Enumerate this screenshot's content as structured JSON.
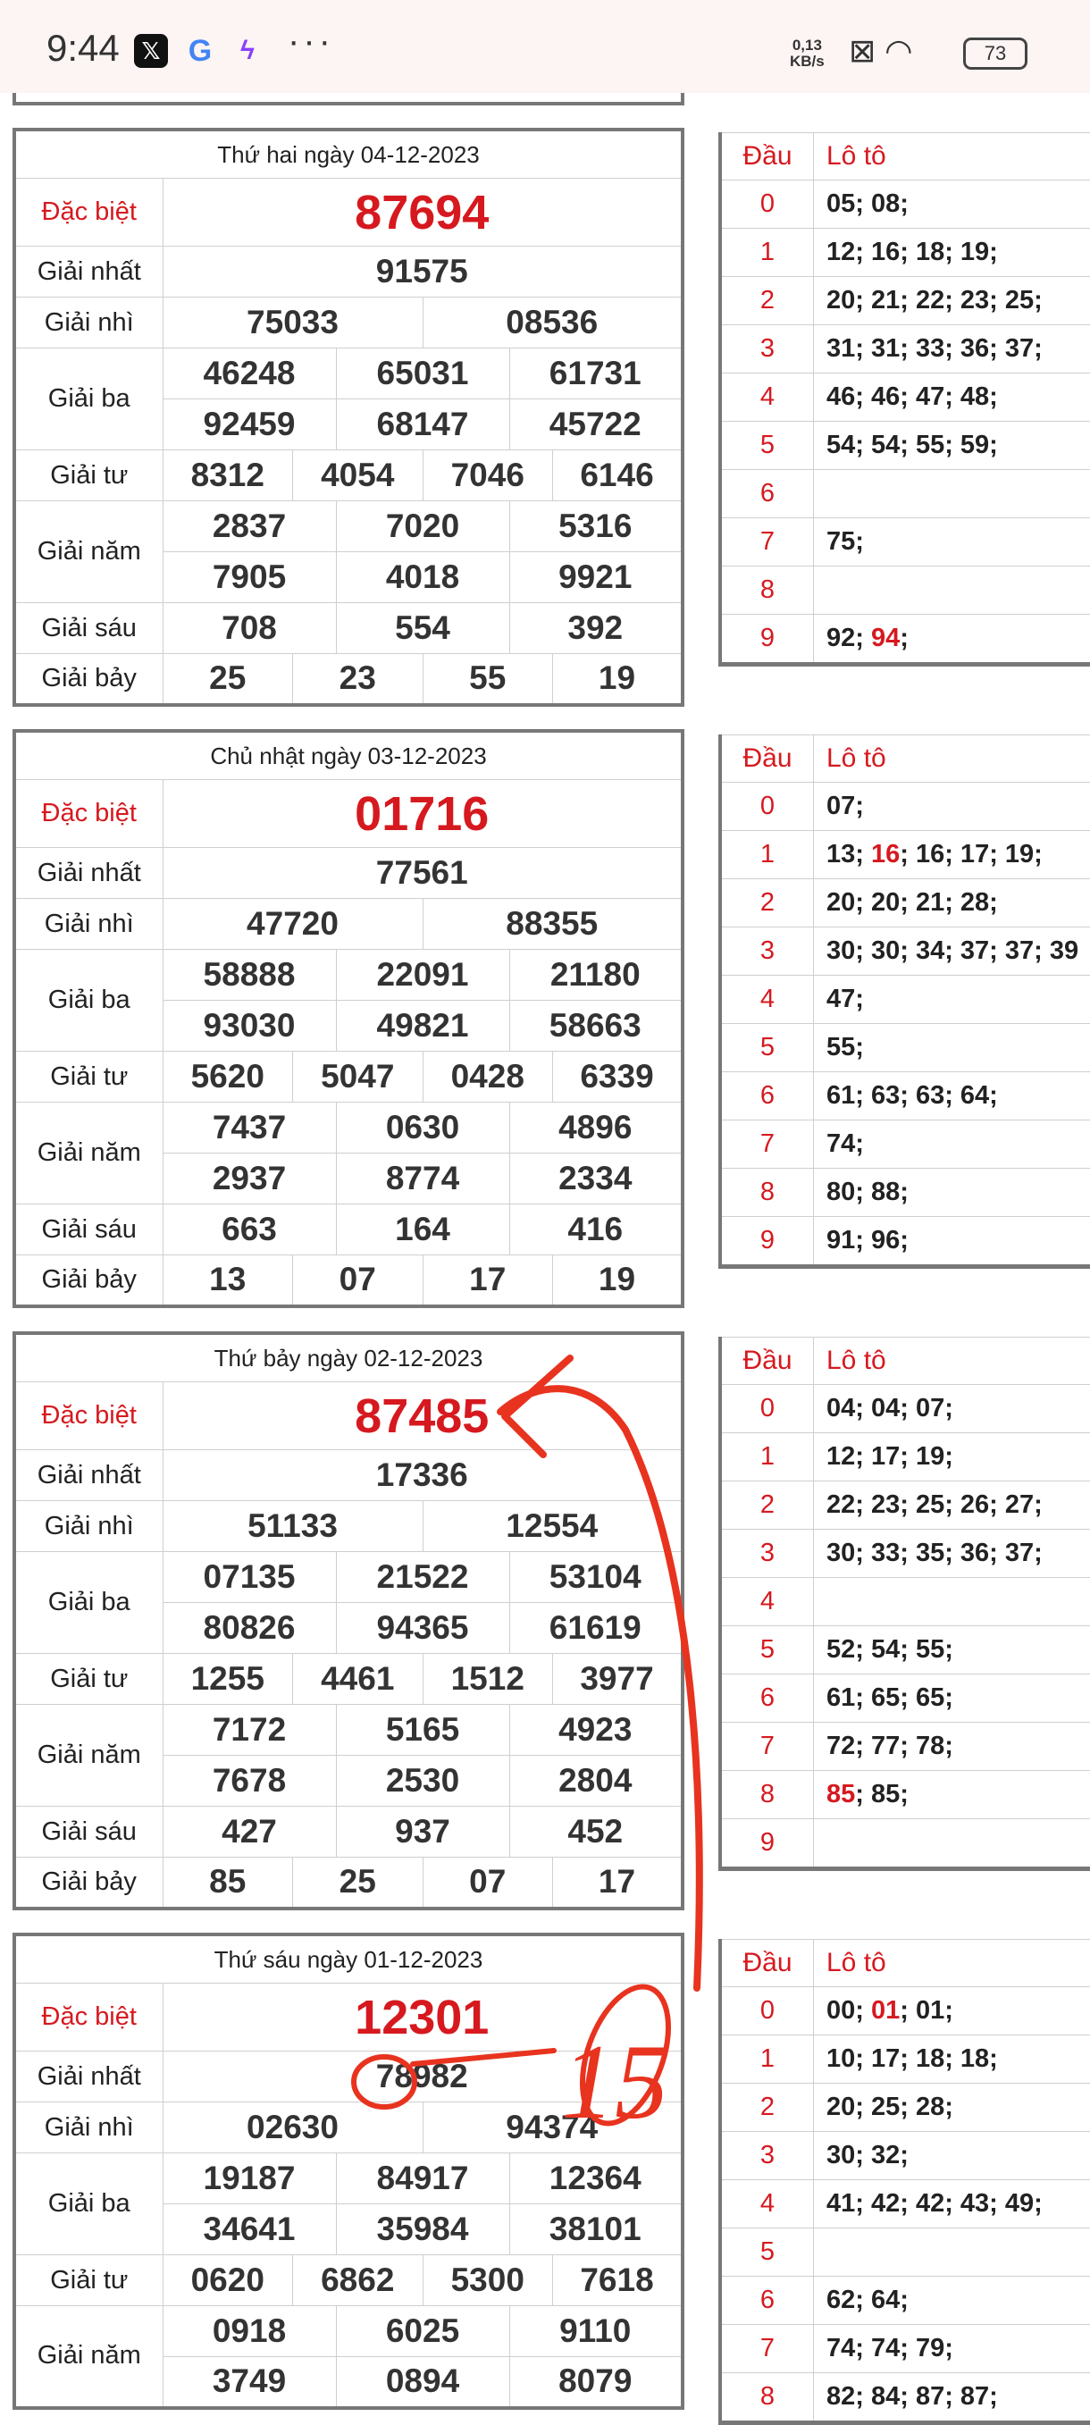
{
  "status_bar": {
    "time": "9:44",
    "apps": [
      "x-app-icon",
      "google-icon",
      "messenger-icon"
    ],
    "more": "···",
    "speed_value": "0,13",
    "speed_unit": "KB/s",
    "battery": "73"
  },
  "labels": {
    "db": "Đặc biệt",
    "g1": "Giải nhất",
    "g2": "Giải nhì",
    "g3": "Giải ba",
    "g4": "Giải tư",
    "g5": "Giải năm",
    "g6": "Giải sáu",
    "g7": "Giải bảy",
    "dau": "Đầu",
    "loto": "Lô tô"
  },
  "draws": [
    {
      "date_title": "Thứ hai ngày 04-12-2023",
      "db": "87694",
      "g1": "91575",
      "g2": [
        "75033",
        "08536"
      ],
      "g3": [
        "46248",
        "65031",
        "61731",
        "92459",
        "68147",
        "45722"
      ],
      "g4": [
        "8312",
        "4054",
        "7046",
        "6146"
      ],
      "g5": [
        "2837",
        "7020",
        "5316",
        "7905",
        "4018",
        "9921"
      ],
      "g6": [
        "708",
        "554",
        "392"
      ],
      "g7": [
        "25",
        "23",
        "55",
        "19"
      ],
      "loto": [
        {
          "d": "0",
          "pre": "05; 08;",
          "hl": "",
          "post": ""
        },
        {
          "d": "1",
          "pre": "12; 16; 18; 19;",
          "hl": "",
          "post": ""
        },
        {
          "d": "2",
          "pre": "20; 21; 22; 23; 25;",
          "hl": "",
          "post": ""
        },
        {
          "d": "3",
          "pre": "31; 31; 33; 36; 37;",
          "hl": "",
          "post": ""
        },
        {
          "d": "4",
          "pre": "46; 46; 47; 48;",
          "hl": "",
          "post": ""
        },
        {
          "d": "5",
          "pre": "54; 54; 55; 59;",
          "hl": "",
          "post": ""
        },
        {
          "d": "6",
          "pre": "",
          "hl": "",
          "post": ""
        },
        {
          "d": "7",
          "pre": "75;",
          "hl": "",
          "post": ""
        },
        {
          "d": "8",
          "pre": "",
          "hl": "",
          "post": ""
        },
        {
          "d": "9",
          "pre": "92; ",
          "hl": "94",
          "post": ";"
        }
      ]
    },
    {
      "date_title": "Chủ nhật ngày 03-12-2023",
      "db": "01716",
      "g1": "77561",
      "g2": [
        "47720",
        "88355"
      ],
      "g3": [
        "58888",
        "22091",
        "21180",
        "93030",
        "49821",
        "58663"
      ],
      "g4": [
        "5620",
        "5047",
        "0428",
        "6339"
      ],
      "g5": [
        "7437",
        "0630",
        "4896",
        "2937",
        "8774",
        "2334"
      ],
      "g6": [
        "663",
        "164",
        "416"
      ],
      "g7": [
        "13",
        "07",
        "17",
        "19"
      ],
      "loto": [
        {
          "d": "0",
          "pre": "07;",
          "hl": "",
          "post": ""
        },
        {
          "d": "1",
          "pre": "13; ",
          "hl": "16",
          "post": "; 16; 17; 19;"
        },
        {
          "d": "2",
          "pre": "20; 20; 21; 28;",
          "hl": "",
          "post": ""
        },
        {
          "d": "3",
          "pre": "30; 30; 34; 37; 37; 39",
          "hl": "",
          "post": ""
        },
        {
          "d": "4",
          "pre": "47;",
          "hl": "",
          "post": ""
        },
        {
          "d": "5",
          "pre": "55;",
          "hl": "",
          "post": ""
        },
        {
          "d": "6",
          "pre": "61; 63; 63; 64;",
          "hl": "",
          "post": ""
        },
        {
          "d": "7",
          "pre": "74;",
          "hl": "",
          "post": ""
        },
        {
          "d": "8",
          "pre": "80; 88;",
          "hl": "",
          "post": ""
        },
        {
          "d": "9",
          "pre": "91; 96;",
          "hl": "",
          "post": ""
        }
      ]
    },
    {
      "date_title": "Thứ bảy ngày 02-12-2023",
      "db": "87485",
      "g1": "17336",
      "g2": [
        "51133",
        "12554"
      ],
      "g3": [
        "07135",
        "21522",
        "53104",
        "80826",
        "94365",
        "61619"
      ],
      "g4": [
        "1255",
        "4461",
        "1512",
        "3977"
      ],
      "g5": [
        "7172",
        "5165",
        "4923",
        "7678",
        "2530",
        "2804"
      ],
      "g6": [
        "427",
        "937",
        "452"
      ],
      "g7": [
        "85",
        "25",
        "07",
        "17"
      ],
      "loto": [
        {
          "d": "0",
          "pre": "04; 04; 07;",
          "hl": "",
          "post": ""
        },
        {
          "d": "1",
          "pre": "12; 17; 19;",
          "hl": "",
          "post": ""
        },
        {
          "d": "2",
          "pre": "22; 23; 25; 26; 27;",
          "hl": "",
          "post": ""
        },
        {
          "d": "3",
          "pre": "30; 33; 35; 36; 37;",
          "hl": "",
          "post": ""
        },
        {
          "d": "4",
          "pre": "",
          "hl": "",
          "post": ""
        },
        {
          "d": "5",
          "pre": "52; 54; 55;",
          "hl": "",
          "post": ""
        },
        {
          "d": "6",
          "pre": "61; 65; 65;",
          "hl": "",
          "post": ""
        },
        {
          "d": "7",
          "pre": "72; 77; 78;",
          "hl": "",
          "post": ""
        },
        {
          "d": "8",
          "pre": "",
          "hl": "85",
          "post": "; 85;"
        },
        {
          "d": "9",
          "pre": "",
          "hl": "",
          "post": ""
        }
      ]
    },
    {
      "date_title": "Thứ sáu ngày 01-12-2023",
      "db": "12301",
      "g1": "78982",
      "g2": [
        "02630",
        "94374"
      ],
      "g3": [
        "19187",
        "84917",
        "12364",
        "34641",
        "35984",
        "38101"
      ],
      "g4": [
        "0620",
        "6862",
        "5300",
        "7618"
      ],
      "g5": [
        "0918",
        "6025",
        "9110",
        "3749",
        "0894",
        "8079"
      ],
      "g6": [],
      "g7": [],
      "loto": [
        {
          "d": "0",
          "pre": "00; ",
          "hl": "01",
          "post": "; 01;"
        },
        {
          "d": "1",
          "pre": "10; 17; 18; 18;",
          "hl": "",
          "post": ""
        },
        {
          "d": "2",
          "pre": "20; 25; 28;",
          "hl": "",
          "post": ""
        },
        {
          "d": "3",
          "pre": "30; 32;",
          "hl": "",
          "post": ""
        },
        {
          "d": "4",
          "pre": "41; 42; 42; 43; 49;",
          "hl": "",
          "post": ""
        },
        {
          "d": "5",
          "pre": "",
          "hl": "",
          "post": ""
        },
        {
          "d": "6",
          "pre": "62; 64;",
          "hl": "",
          "post": ""
        },
        {
          "d": "7",
          "pre": "74; 74; 79;",
          "hl": "",
          "post": ""
        },
        {
          "d": "8",
          "pre": "82; 84; 87; 87;",
          "hl": "",
          "post": ""
        }
      ]
    }
  ],
  "annotation_text": "15"
}
